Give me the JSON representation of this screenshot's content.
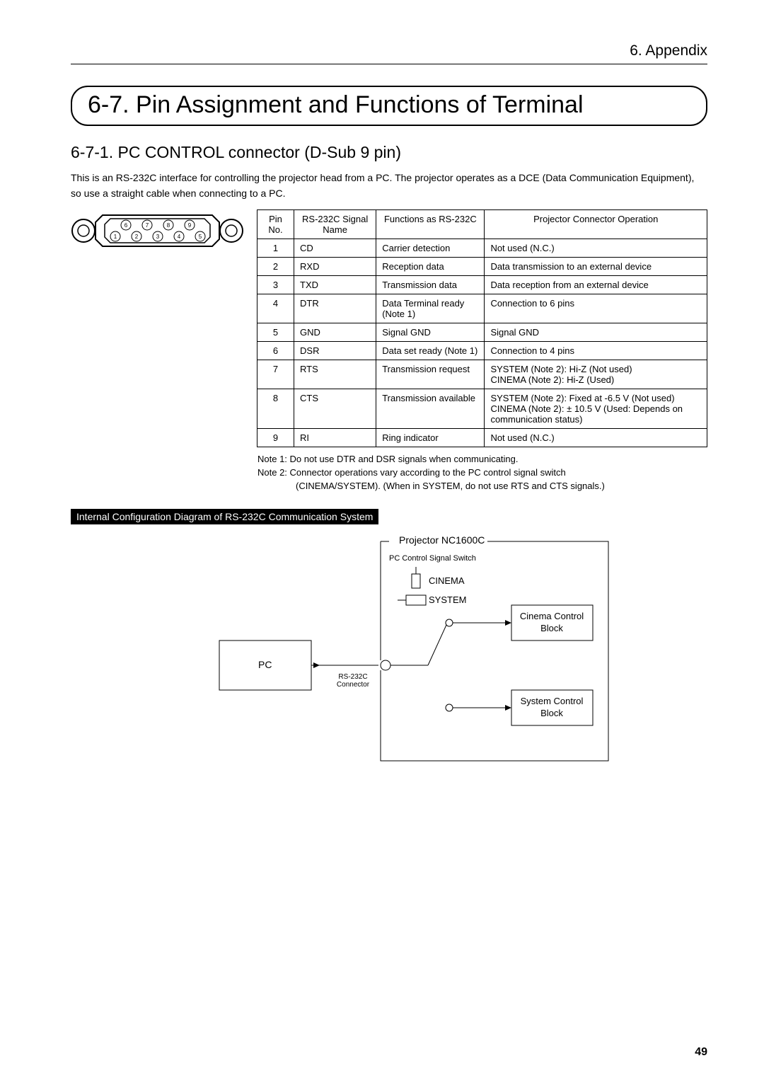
{
  "header": {
    "chapter": "6. Appendix"
  },
  "section_title": "6-7. Pin Assignment and Functions of Terminal",
  "subsection_title": "6-7-1. PC CONTROL connector (D-Sub 9 pin)",
  "intro": "This is an RS-232C interface for controlling the projector head from a PC. The projector operates as a DCE (Data Communication Equipment), so use a straight cable when connecting to a PC.",
  "table": {
    "head": {
      "pin": "Pin No.",
      "signal": "RS-232C Signal Name",
      "func": "Functions as RS-232C",
      "op": "Projector Connector Operation"
    },
    "rows": [
      {
        "pin": "1",
        "signal": "CD",
        "func": "Carrier detection",
        "op": "Not used (N.C.)"
      },
      {
        "pin": "2",
        "signal": "RXD",
        "func": "Reception data",
        "op": "Data transmission to an external device"
      },
      {
        "pin": "3",
        "signal": "TXD",
        "func": "Transmission data",
        "op": "Data reception from an external device"
      },
      {
        "pin": "4",
        "signal": "DTR",
        "func": "Data Terminal ready (Note 1)",
        "op": "Connection to 6 pins"
      },
      {
        "pin": "5",
        "signal": "GND",
        "func": "Signal GND",
        "op": "Signal GND"
      },
      {
        "pin": "6",
        "signal": "DSR",
        "func": "Data set ready (Note 1)",
        "op": "Connection to 4 pins"
      },
      {
        "pin": "7",
        "signal": "RTS",
        "func": "Transmission request",
        "op": "SYSTEM (Note 2): Hi-Z (Not used)\nCINEMA (Note 2): Hi-Z (Used)"
      },
      {
        "pin": "8",
        "signal": "CTS",
        "func": "Transmission available",
        "op": "SYSTEM (Note 2): Fixed at -6.5 V (Not used)\nCINEMA (Note 2): ± 10.5 V (Used: Depends on communication status)"
      },
      {
        "pin": "9",
        "signal": "RI",
        "func": "Ring indicator",
        "op": "Not used (N.C.)"
      }
    ]
  },
  "connector_pins": [
    "1",
    "2",
    "3",
    "4",
    "5",
    "6",
    "7",
    "8",
    "9"
  ],
  "notes": [
    "Note 1:  Do not use DTR and DSR signals when communicating.",
    "Note 2:  Connector operations vary according to the PC control signal switch",
    "(CINEMA/SYSTEM). (When in SYSTEM, do not use RTS and CTS signals.)"
  ],
  "diagram_title": "Internal Configuration Diagram of RS-232C Communication System",
  "diagram": {
    "frame_label": "Projector NC1600C",
    "switch_title": "PC Control Signal Switch",
    "cinema": "CINEMA",
    "system": "SYSTEM",
    "pc": "PC",
    "conn_label": "RS-232C Connector",
    "cinema_block": "Cinema Control Block",
    "system_block": "System Control Block"
  },
  "page_number": "49"
}
